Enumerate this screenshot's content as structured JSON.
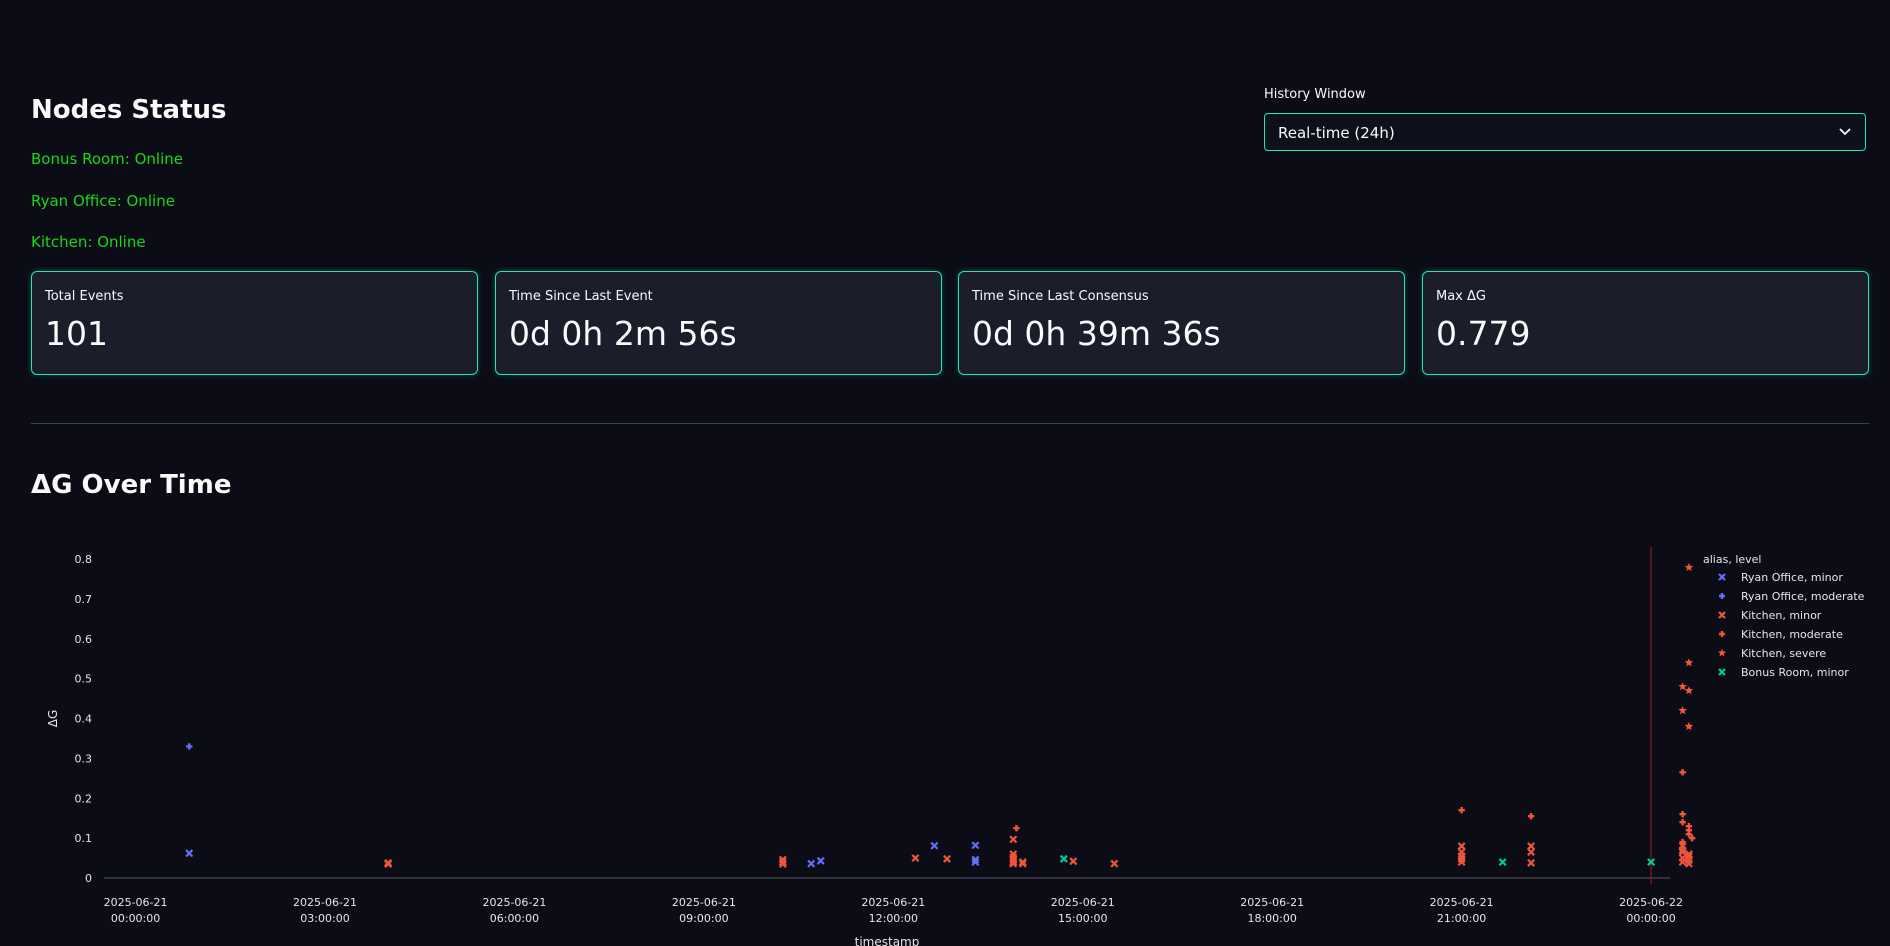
{
  "nodes": {
    "title": "Nodes Status",
    "items": [
      {
        "label": "Bonus Room: Online"
      },
      {
        "label": "Ryan Office: Online"
      },
      {
        "label": "Kitchen: Online"
      }
    ]
  },
  "history": {
    "label": "History Window",
    "selected": "Real-time (24h)"
  },
  "metrics": [
    {
      "label": "Total Events",
      "value": "101"
    },
    {
      "label": "Time Since Last Event",
      "value": "0d 0h 2m 56s"
    },
    {
      "label": "Time Since Last Consensus",
      "value": "0d 0h 39m 36s"
    },
    {
      "label": "Max ΔG",
      "value": "0.779"
    }
  ],
  "chart_section": {
    "title": "ΔG Over Time"
  },
  "colors": {
    "accent": "#1de9b6",
    "online": "#16d916",
    "ryan": "#636efa",
    "kitchen": "#ef553b",
    "bonus": "#00cc96",
    "marker_line": "#8b1a1a"
  },
  "chart_data": {
    "type": "scatter",
    "title": "",
    "xlabel": "timestamp",
    "ylabel": "ΔG",
    "xlim": [
      -0.5,
      24.3
    ],
    "ylim": [
      0,
      0.8
    ],
    "x_units": "hours after 2025-06-21 00:00:00",
    "x_ticks": [
      {
        "x": 0,
        "date": "2025-06-21",
        "time": "00:00:00"
      },
      {
        "x": 3,
        "date": "2025-06-21",
        "time": "03:00:00"
      },
      {
        "x": 6,
        "date": "2025-06-21",
        "time": "06:00:00"
      },
      {
        "x": 9,
        "date": "2025-06-21",
        "time": "09:00:00"
      },
      {
        "x": 12,
        "date": "2025-06-21",
        "time": "12:00:00"
      },
      {
        "x": 15,
        "date": "2025-06-21",
        "time": "15:00:00"
      },
      {
        "x": 18,
        "date": "2025-06-21",
        "time": "18:00:00"
      },
      {
        "x": 21,
        "date": "2025-06-21",
        "time": "21:00:00"
      },
      {
        "x": 24,
        "date": "2025-06-22",
        "time": "00:00:00"
      }
    ],
    "y_ticks": [
      0,
      0.1,
      0.2,
      0.3,
      0.4,
      0.5,
      0.6,
      0.7,
      0.8
    ],
    "vline_x": 24.0,
    "legend": {
      "title": "alias, level",
      "placement": "right"
    },
    "series": [
      {
        "name": "Ryan Office, minor",
        "color": "#636efa",
        "symbol": "x",
        "points": [
          [
            0.85,
            0.062
          ],
          [
            10.7,
            0.036
          ],
          [
            10.85,
            0.043
          ],
          [
            12.65,
            0.081
          ],
          [
            13.3,
            0.082
          ],
          [
            13.3,
            0.046
          ],
          [
            13.3,
            0.04
          ]
        ]
      },
      {
        "name": "Ryan Office, moderate",
        "color": "#636efa",
        "symbol": "cross",
        "points": [
          [
            0.85,
            0.33
          ]
        ]
      },
      {
        "name": "Kitchen, minor",
        "color": "#ef553b",
        "symbol": "x",
        "points": [
          [
            4.0,
            0.038
          ],
          [
            4.0,
            0.035
          ],
          [
            10.25,
            0.046
          ],
          [
            10.25,
            0.04
          ],
          [
            10.25,
            0.035
          ],
          [
            12.35,
            0.05
          ],
          [
            12.85,
            0.048
          ],
          [
            13.9,
            0.097
          ],
          [
            13.9,
            0.06
          ],
          [
            13.9,
            0.052
          ],
          [
            13.9,
            0.045
          ],
          [
            13.9,
            0.04
          ],
          [
            13.9,
            0.036
          ],
          [
            14.05,
            0.04
          ],
          [
            14.05,
            0.036
          ],
          [
            14.85,
            0.042
          ],
          [
            15.5,
            0.036
          ],
          [
            21.0,
            0.08
          ],
          [
            21.0,
            0.065
          ],
          [
            21.0,
            0.055
          ],
          [
            21.0,
            0.048
          ],
          [
            21.0,
            0.04
          ],
          [
            22.1,
            0.08
          ],
          [
            22.1,
            0.065
          ],
          [
            22.1,
            0.038
          ],
          [
            24.5,
            0.08
          ],
          [
            24.5,
            0.07
          ],
          [
            24.5,
            0.065
          ],
          [
            24.6,
            0.06
          ],
          [
            24.6,
            0.055
          ],
          [
            24.5,
            0.05
          ],
          [
            24.6,
            0.045
          ],
          [
            24.5,
            0.04
          ],
          [
            24.6,
            0.036
          ]
        ]
      },
      {
        "name": "Kitchen, moderate",
        "color": "#ef553b",
        "symbol": "cross",
        "points": [
          [
            13.95,
            0.125
          ],
          [
            21.0,
            0.17
          ],
          [
            22.1,
            0.155
          ],
          [
            24.5,
            0.265
          ],
          [
            24.5,
            0.16
          ],
          [
            24.5,
            0.14
          ],
          [
            24.6,
            0.13
          ],
          [
            24.6,
            0.12
          ],
          [
            24.6,
            0.11
          ],
          [
            24.5,
            0.09
          ],
          [
            24.65,
            0.1
          ]
        ]
      },
      {
        "name": "Kitchen, severe",
        "color": "#ef553b",
        "symbol": "star",
        "points": [
          [
            24.6,
            0.779
          ],
          [
            24.6,
            0.54
          ],
          [
            24.5,
            0.48
          ],
          [
            24.6,
            0.47
          ],
          [
            24.5,
            0.42
          ],
          [
            24.6,
            0.38
          ]
        ]
      },
      {
        "name": "Bonus Room, minor",
        "color": "#00cc96",
        "symbol": "x",
        "points": [
          [
            14.7,
            0.048
          ],
          [
            21.65,
            0.04
          ],
          [
            24.0,
            0.04
          ]
        ]
      }
    ]
  }
}
